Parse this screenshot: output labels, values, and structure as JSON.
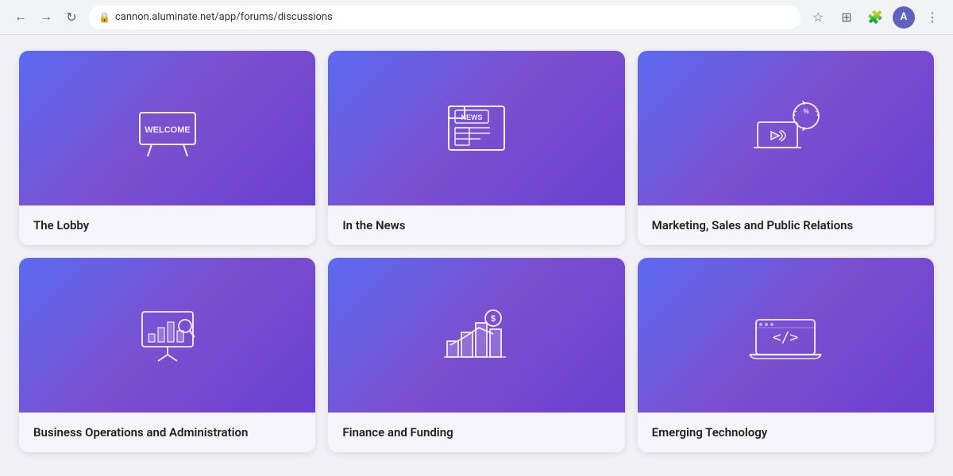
{
  "browser": {
    "url": "cannon.aluminate.net/app/forums/discussions",
    "back_title": "Back",
    "forward_title": "Forward",
    "reload_title": "Reload"
  },
  "forums": [
    {
      "id": "lobby",
      "label": "The Lobby",
      "icon": "welcome-sign"
    },
    {
      "id": "news",
      "label": "In the News",
      "icon": "newspaper"
    },
    {
      "id": "marketing",
      "label": "Marketing, Sales and Public Relations",
      "icon": "megaphone-sale"
    },
    {
      "id": "business",
      "label": "Business Operations and Administration",
      "icon": "analytics-board"
    },
    {
      "id": "finance",
      "label": "Finance and Funding",
      "icon": "bar-chart-money"
    },
    {
      "id": "tech",
      "label": "Emerging Technology",
      "icon": "laptop-code"
    }
  ]
}
